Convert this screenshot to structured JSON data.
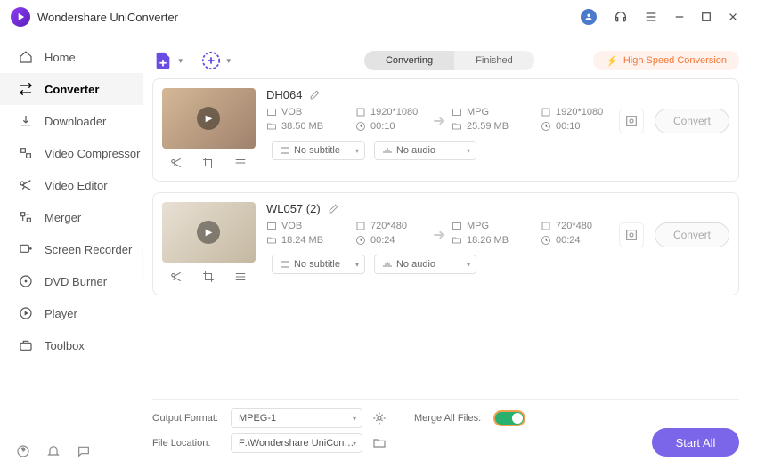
{
  "app": {
    "title": "Wondershare UniConverter"
  },
  "nav": [
    "Home",
    "Converter",
    "Downloader",
    "Video Compressor",
    "Video Editor",
    "Merger",
    "Screen Recorder",
    "DVD Burner",
    "Player",
    "Toolbox"
  ],
  "tabs": {
    "active": "Converting",
    "other": "Finished"
  },
  "hs_label": "High Speed Conversion",
  "files": [
    {
      "name": "DH064",
      "in": {
        "fmt": "VOB",
        "res": "1920*1080",
        "size": "38.50 MB",
        "dur": "00:10"
      },
      "out": {
        "fmt": "MPG",
        "res": "1920*1080",
        "size": "25.59 MB",
        "dur": "00:10"
      },
      "sub": "No subtitle",
      "aud": "No audio",
      "btn": "Convert"
    },
    {
      "name": "WL057 (2)",
      "in": {
        "fmt": "VOB",
        "res": "720*480",
        "size": "18.24 MB",
        "dur": "00:24"
      },
      "out": {
        "fmt": "MPG",
        "res": "720*480",
        "size": "18.26 MB",
        "dur": "00:24"
      },
      "sub": "No subtitle",
      "aud": "No audio",
      "btn": "Convert"
    }
  ],
  "footer": {
    "out_fmt_label": "Output Format:",
    "out_fmt": "MPEG-1",
    "loc_label": "File Location:",
    "loc": "F:\\Wondershare UniConverter",
    "merge_label": "Merge All Files:",
    "start": "Start All"
  }
}
